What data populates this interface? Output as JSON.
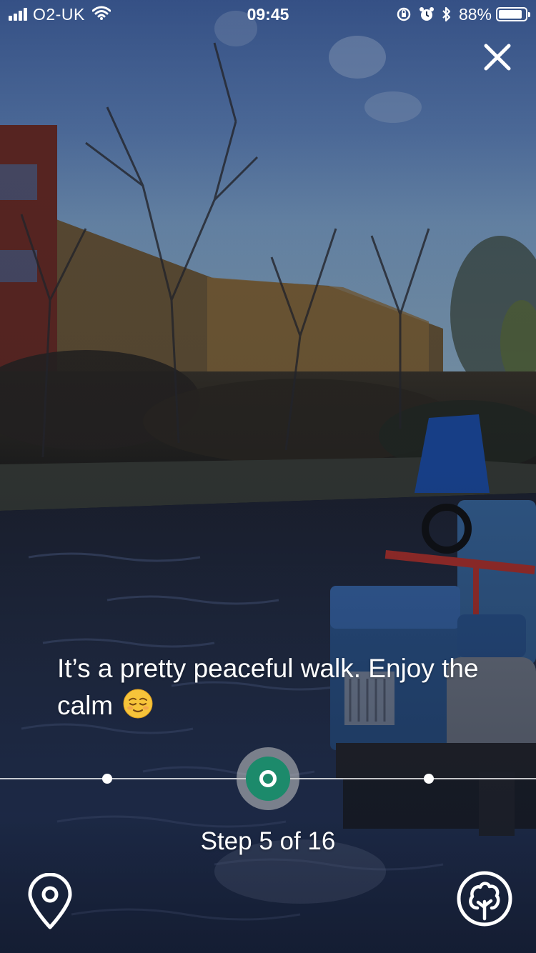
{
  "status_bar": {
    "carrier": "O2-UK",
    "time": "09:45",
    "battery_percent": "88%",
    "battery_level": 0.88,
    "icons": [
      "signal-icon",
      "wifi-icon",
      "rotation-lock-icon",
      "alarm-icon",
      "bluetooth-icon",
      "battery-icon"
    ]
  },
  "close_button": {
    "icon": "close-icon"
  },
  "caption": {
    "text": "It’s a pretty peaceful walk. Enjoy the calm",
    "emoji": "relieved-face-emoji"
  },
  "progress": {
    "current_step": 5,
    "total_steps": 16,
    "label": "Step 5 of 16",
    "accent_color": "#1c8a6b"
  },
  "bottom_buttons": {
    "left_icon": "map-pin-icon",
    "right_icon": "tree-icon"
  }
}
